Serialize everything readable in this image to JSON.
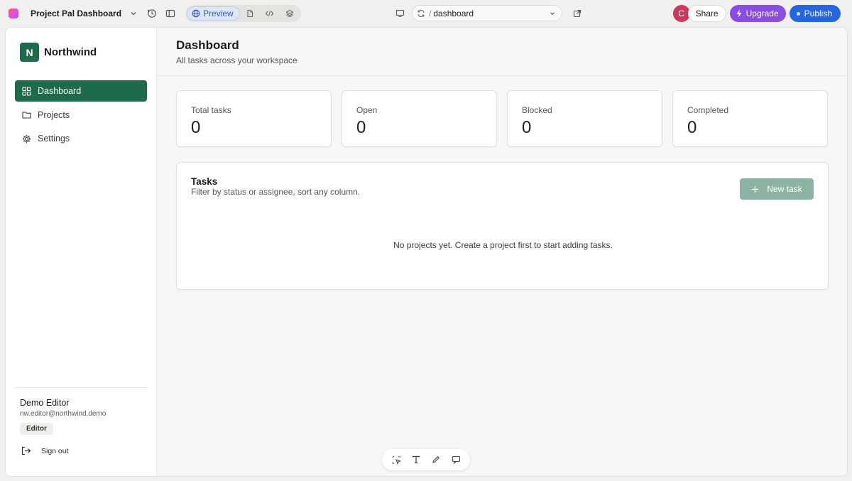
{
  "topbar": {
    "project_title": "Project Pal Dashboard",
    "preview_label": "Preview",
    "url_path": "dashboard",
    "url_slash": "/",
    "avatar_initial": "C",
    "share_label": "Share",
    "upgrade_label": "Upgrade",
    "publish_label": "Publish"
  },
  "sidebar": {
    "brand_initial": "N",
    "brand_name": "Northwind",
    "items": [
      {
        "label": "Dashboard",
        "icon": "grid-icon",
        "active": true
      },
      {
        "label": "Projects",
        "icon": "folder-icon",
        "active": false
      },
      {
        "label": "Settings",
        "icon": "gear-icon",
        "active": false
      }
    ],
    "user": {
      "name": "Demo Editor",
      "email": "nw.editor@northwind.demo",
      "role": "Editor"
    },
    "signout_label": "Sign out"
  },
  "page": {
    "title": "Dashboard",
    "subtitle": "All tasks across your workspace"
  },
  "stats": [
    {
      "label": "Total tasks",
      "value": "0"
    },
    {
      "label": "Open",
      "value": "0"
    },
    {
      "label": "Blocked",
      "value": "0"
    },
    {
      "label": "Completed",
      "value": "0"
    }
  ],
  "tasks": {
    "title": "Tasks",
    "subtitle": "Filter by status or assignee, sort any column.",
    "new_task_label": "New task",
    "empty_message": "No projects yet. Create a project first to start adding tasks."
  },
  "colors": {
    "brand_green": "#1d6b4a",
    "new_task_disabled": "#8db4a2",
    "upgrade_purple": "#8a4ce6",
    "publish_blue": "#2764e0"
  }
}
